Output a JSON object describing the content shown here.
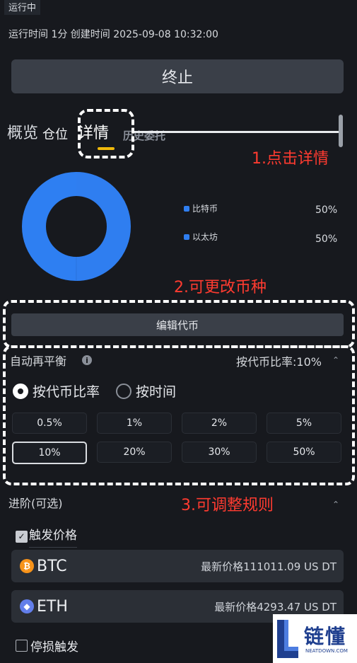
{
  "status": {
    "label": "运行中"
  },
  "run_info": "运行时间 1分 创建时间 2025-09-08 10:32:00",
  "stop_button": "终止",
  "tabs": [
    {
      "label": "概览"
    },
    {
      "label": "仓位"
    },
    {
      "label": "详情"
    },
    {
      "label": "历史委托"
    }
  ],
  "annotations": {
    "step1": "1.点击详情",
    "step2": "2.可更改币种",
    "step3": "3.可调整规则"
  },
  "allocation": {
    "items": [
      {
        "name": "比特币",
        "pct": "50%"
      },
      {
        "name": "以太坊",
        "pct": "50%"
      }
    ],
    "color": "#2f7ef0"
  },
  "edit_coin_button": "编辑代币",
  "rebalance": {
    "title": "自动再平衡",
    "summary": "按代币比率:10%",
    "mode_ratio": "按代币比率",
    "mode_time": "按时间",
    "options": [
      "0.5%",
      "1%",
      "2%",
      "5%",
      "10%",
      "20%",
      "30%",
      "50%"
    ],
    "selected": "10%"
  },
  "advanced": {
    "title": "进阶(可选)",
    "trigger_label": "触发价格",
    "coins": [
      {
        "symbol": "BTC",
        "price": "最新价格111011.09 US DT",
        "icon": "bitcoin-icon",
        "color": "#f7931a"
      },
      {
        "symbol": "ETH",
        "price": "最新价格4293.47 US DT",
        "icon": "ethereum-icon",
        "color": "#627eea"
      }
    ],
    "stop_loss_label": "停损触发"
  },
  "logo": {
    "cn": "链懂",
    "en": "NEATDOWN.COM"
  }
}
